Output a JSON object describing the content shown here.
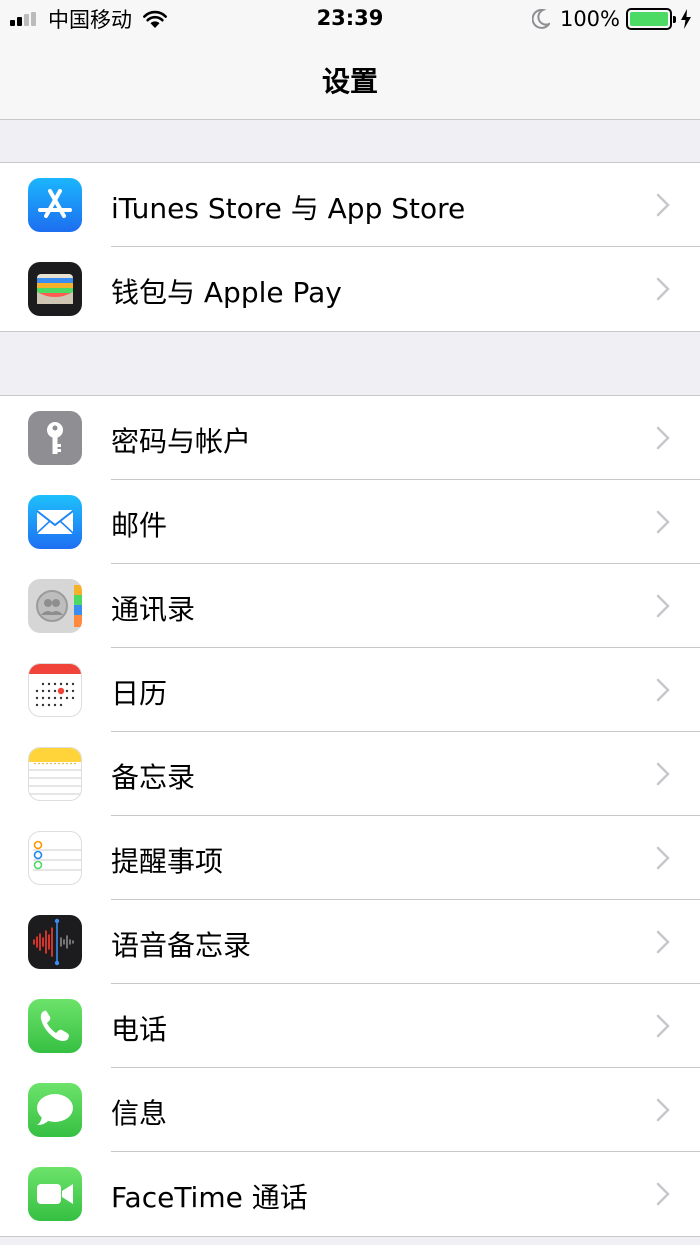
{
  "status_bar": {
    "carrier": "中国移动",
    "time": "23:39",
    "battery": "100%",
    "battery_color": "#4cd964"
  },
  "nav": {
    "title": "设置"
  },
  "groups": [
    {
      "items": [
        {
          "label": "iTunes Store 与 App Store",
          "icon": "app-store-icon"
        },
        {
          "label": "钱包与 Apple Pay",
          "icon": "wallet-icon"
        }
      ]
    },
    {
      "items": [
        {
          "label": "密码与帐户",
          "icon": "key-icon"
        },
        {
          "label": "邮件",
          "icon": "mail-icon"
        },
        {
          "label": "通讯录",
          "icon": "contacts-icon"
        },
        {
          "label": "日历",
          "icon": "calendar-icon"
        },
        {
          "label": "备忘录",
          "icon": "notes-icon"
        },
        {
          "label": "提醒事项",
          "icon": "reminders-icon"
        },
        {
          "label": "语音备忘录",
          "icon": "voice-memos-icon"
        },
        {
          "label": "电话",
          "icon": "phone-icon"
        },
        {
          "label": "信息",
          "icon": "messages-icon"
        },
        {
          "label": "FaceTime 通话",
          "icon": "facetime-icon"
        }
      ]
    }
  ],
  "colors": {
    "app_store": "#1d8cf7",
    "wallet": "#1c1c1e",
    "key": "#8e8e93",
    "mail": "#1e86f5",
    "contacts": "#c8c8c8",
    "calendar_red": "#f0433a",
    "notes_yellow": "#ffd43b",
    "voice_red": "#ff3b30",
    "green": "#4cd964",
    "separator": "#c8c7cc",
    "chevron": "#c7c7cc"
  }
}
